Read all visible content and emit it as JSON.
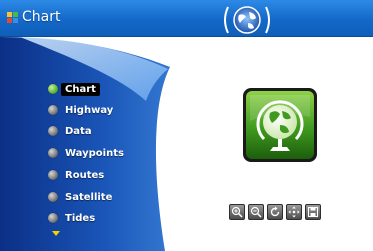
{
  "window": {
    "title": "Chart",
    "app_icon": "puzzle-icon",
    "badge_icon": "globe-icon"
  },
  "menu": {
    "items": [
      {
        "label": "Chart",
        "icon": "chart-bullet-icon",
        "selected": true
      },
      {
        "label": "Highway",
        "icon": "highway-bullet-icon",
        "selected": false
      },
      {
        "label": "Data",
        "icon": "data-bullet-icon",
        "selected": false
      },
      {
        "label": "Waypoints",
        "icon": "waypoints-bullet-icon",
        "selected": false
      },
      {
        "label": "Routes",
        "icon": "routes-bullet-icon",
        "selected": false
      },
      {
        "label": "Satellite",
        "icon": "satellite-bullet-icon",
        "selected": false
      },
      {
        "label": "Tides",
        "icon": "tides-bullet-icon",
        "selected": false
      }
    ],
    "more_icon": "scroll-down-arrow-icon"
  },
  "preview": {
    "icon": "globe-chart-icon"
  },
  "toolbar": {
    "buttons": [
      "zoom-in-icon",
      "zoom-out-icon",
      "rotate-icon",
      "pan-icon",
      "save-icon"
    ]
  },
  "colors": {
    "title_bar": "#1468c8",
    "sidebar_dark": "#0b2f86",
    "sidebar_light": "#2f78d4",
    "accent_green": "#4aa62c",
    "arrow_yellow": "#f2d400"
  }
}
